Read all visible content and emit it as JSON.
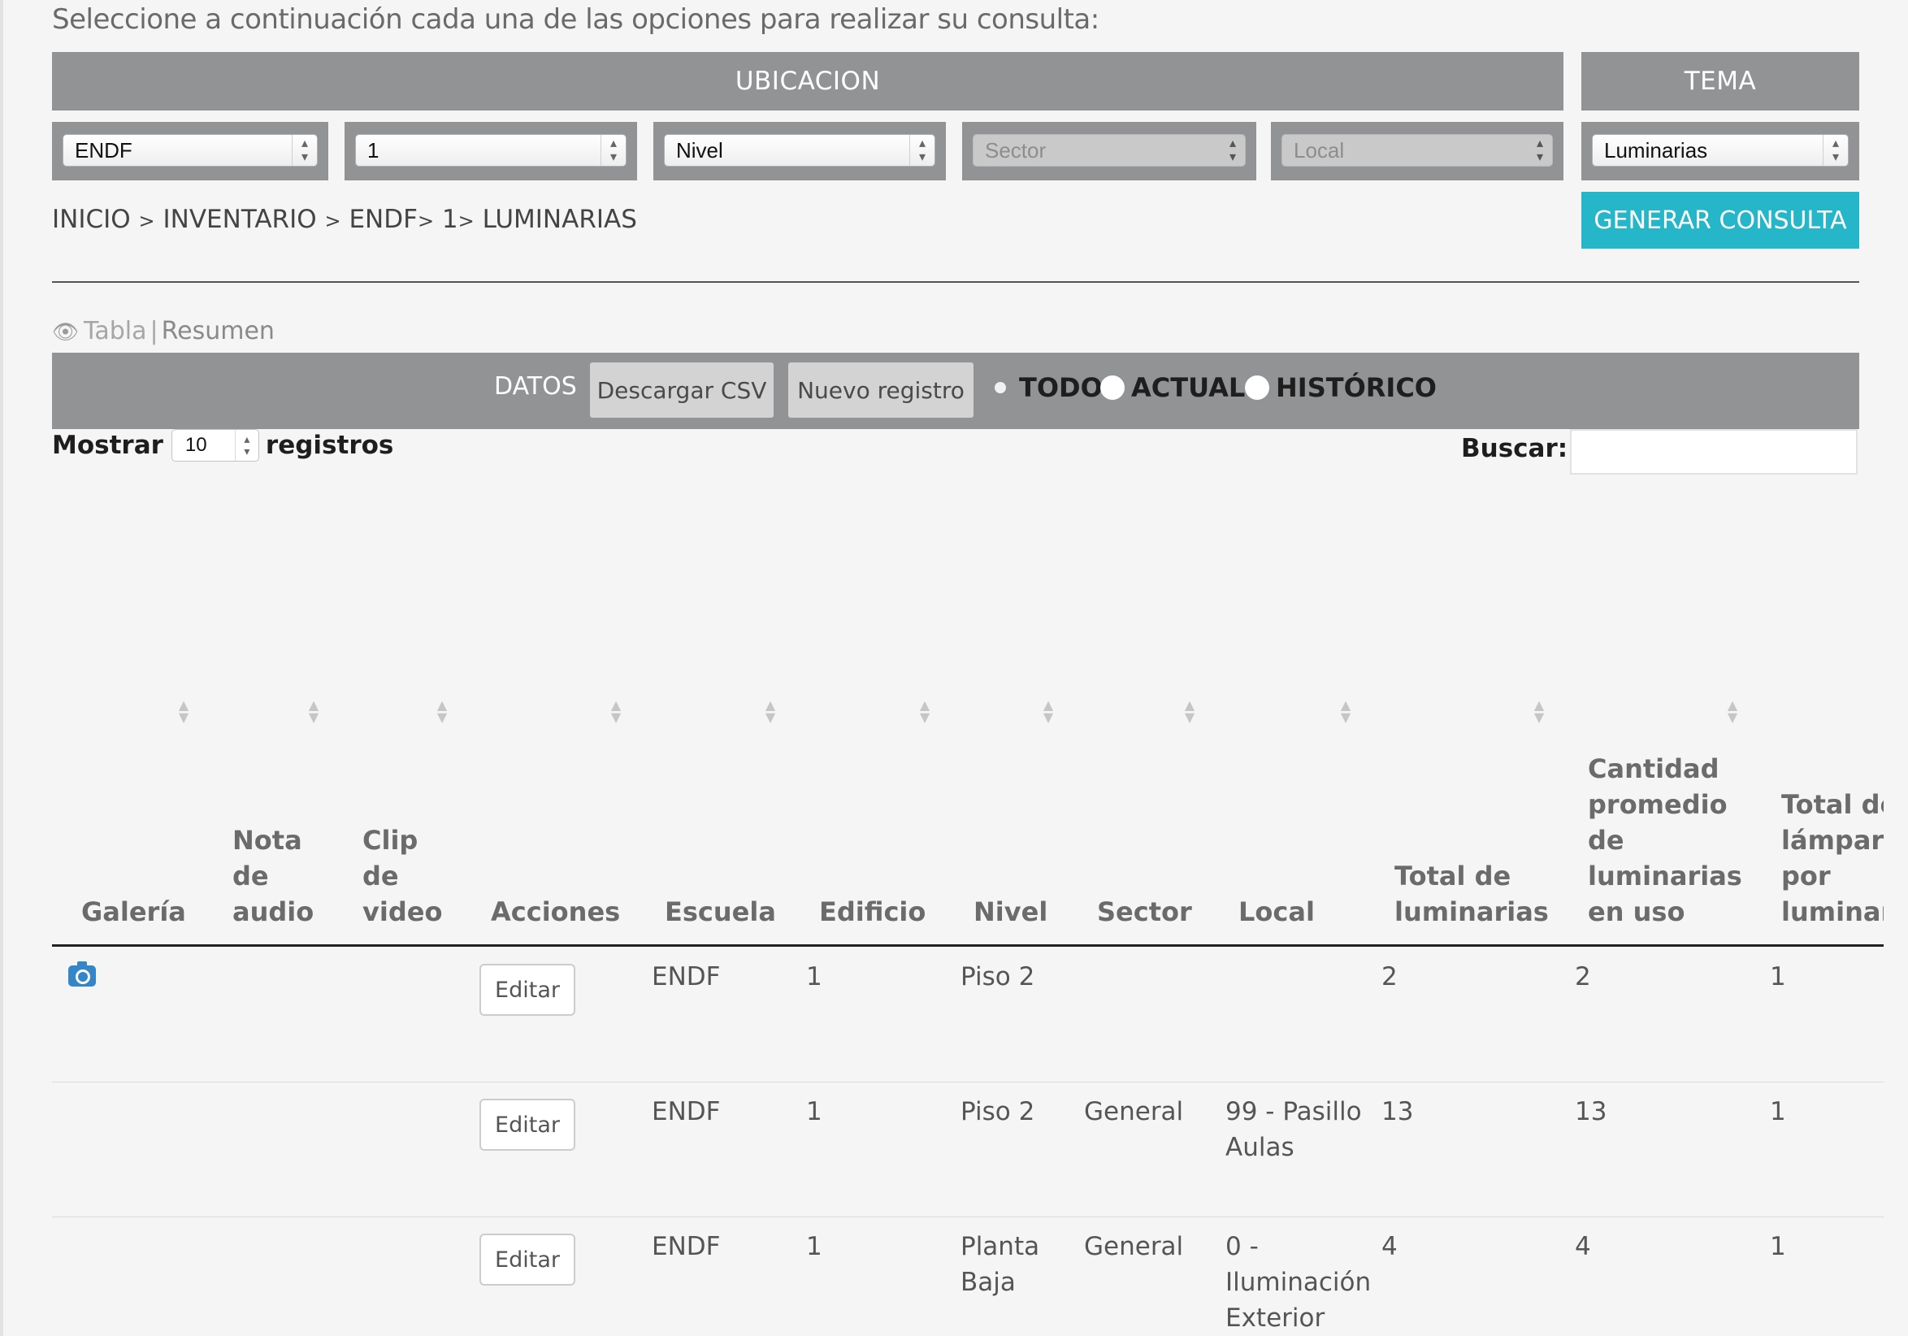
{
  "intro": "Seleccione a continuación cada una de las opciones para realizar su consulta:",
  "filters": {
    "ubicacion_title": "UBICACION",
    "tema_title": "TEMA",
    "escuela": "ENDF",
    "edificio": "1",
    "nivel": "Nivel",
    "sector": "Sector",
    "local": "Local",
    "tema": "Luminarias"
  },
  "breadcrumb": {
    "inicio": "INICIO",
    "inventario": "INVENTARIO",
    "escuela": "ENDF",
    "edificio": "1",
    "tema": "LUMINARIAS",
    "sep": ">"
  },
  "generar_label": "GENERAR CONSULTA",
  "view": {
    "tabla": "Tabla",
    "divider": "|",
    "resumen": "Resumen"
  },
  "datos": {
    "label": "DATOS",
    "csv": "Descargar CSV",
    "nuevo": "Nuevo registro",
    "todo": "TODO",
    "actual": "ACTUAL",
    "historico": "HISTÓRICO",
    "selected": "TODO"
  },
  "mostrar": {
    "label": "Mostrar",
    "value": "10",
    "suffix": "registros"
  },
  "buscar": {
    "label": "Buscar:",
    "value": ""
  },
  "columns": {
    "galeria": "Galería",
    "nota": "Nota de audio",
    "clip": "Clip de video",
    "acciones": "Acciones",
    "escuela": "Escuela",
    "edificio": "Edificio",
    "nivel": "Nivel",
    "sector": "Sector",
    "local": "Local",
    "total": "Total de luminarias",
    "cantidad": "Cantidad promedio de luminarias en uso",
    "lamparas": "Total de lámparas por luminaria"
  },
  "rows": [
    {
      "galeria": "camera-icon",
      "accion": "Editar",
      "escuela": "ENDF",
      "edificio": "1",
      "nivel": "Piso 2",
      "sector": "",
      "local": "",
      "total": "2",
      "cantidad": "2",
      "lamparas": "1"
    },
    {
      "galeria": "",
      "accion": "Editar",
      "escuela": "ENDF",
      "edificio": "1",
      "nivel": "Piso 2",
      "sector": "General",
      "local": "99 - Pasillo Aulas",
      "total": "13",
      "cantidad": "13",
      "lamparas": "1"
    },
    {
      "galeria": "",
      "accion": "Editar",
      "escuela": "ENDF",
      "edificio": "1",
      "nivel": "Planta Baja",
      "sector": "General",
      "local": "0 - Iluminación Exterior",
      "total": "4",
      "cantidad": "4",
      "lamparas": "1"
    }
  ]
}
